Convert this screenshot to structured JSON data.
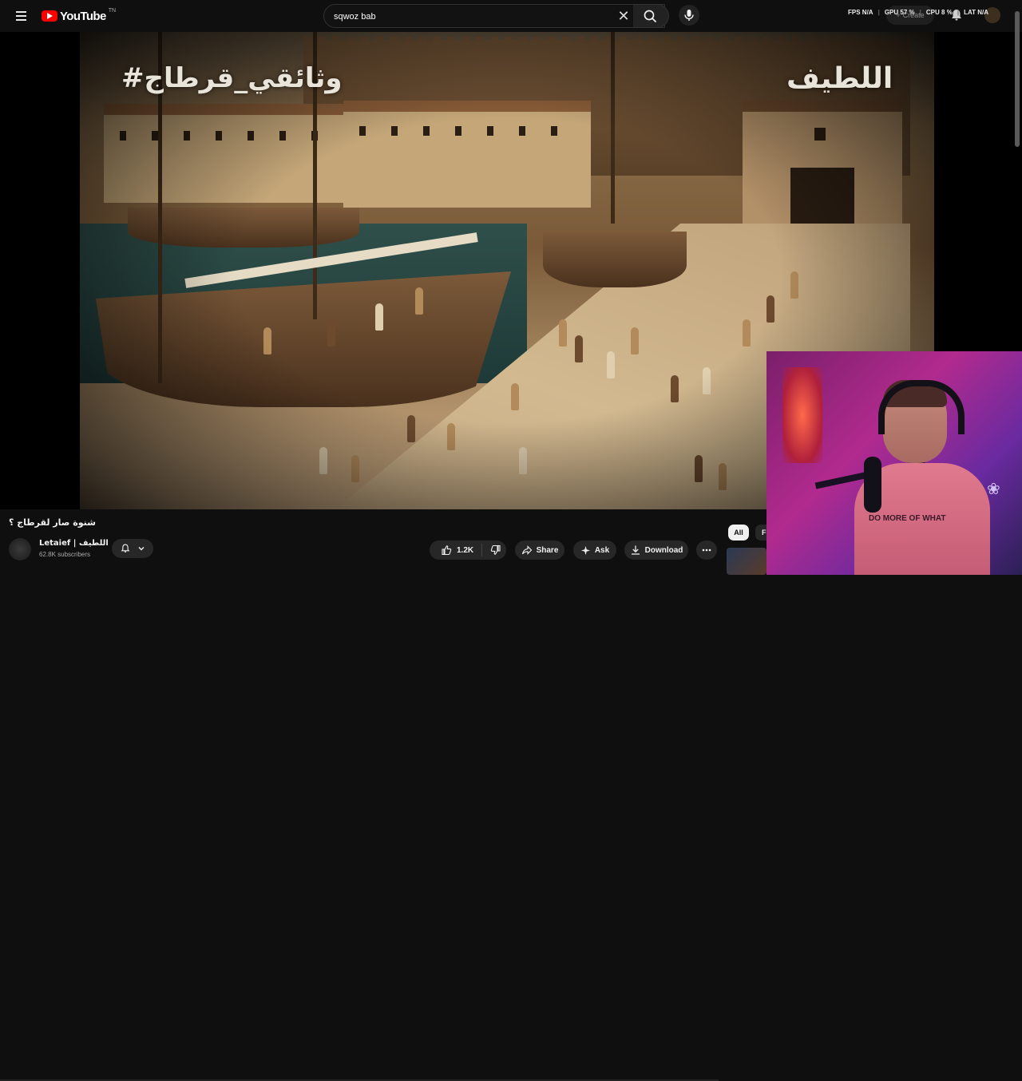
{
  "header": {
    "logo_text": "YouTube",
    "logo_country": "TN",
    "search_value": "sqwoz bab",
    "clear_glyph": "✕",
    "overlay": {
      "fps_label": "FPS",
      "fps_value": "N/A",
      "gpu_label": "GPU",
      "gpu_value": "57 %",
      "cpu_label": "CPU",
      "cpu_value": "8 %",
      "lat_label": "LAT",
      "lat_value": "N/A"
    },
    "create_label": "Create",
    "icons": [
      "menu-icon",
      "search-icon",
      "mic-icon",
      "bell-icon"
    ]
  },
  "video": {
    "overlay_title_left": "#وثائقي_قرطاج",
    "overlay_title_right": "اللطيف",
    "webcam_shirt_text": "DO MORE OF WHAT"
  },
  "info": {
    "title": "شنوة صار لقرطاج ؟",
    "channel_name": "Letaief | اللطيف",
    "subscribers": "62.8K subscribers",
    "like_count": "1.2K",
    "share_label": "Share",
    "ask_label": "Ask",
    "download_label": "Download"
  },
  "chips": {
    "all_label": "All",
    "next_label": "F"
  },
  "colors": {
    "background": "#0f0f0f",
    "brand_red": "#ff0000",
    "pill_bg": "#272727",
    "chip_active_bg": "#f1f1f1"
  }
}
